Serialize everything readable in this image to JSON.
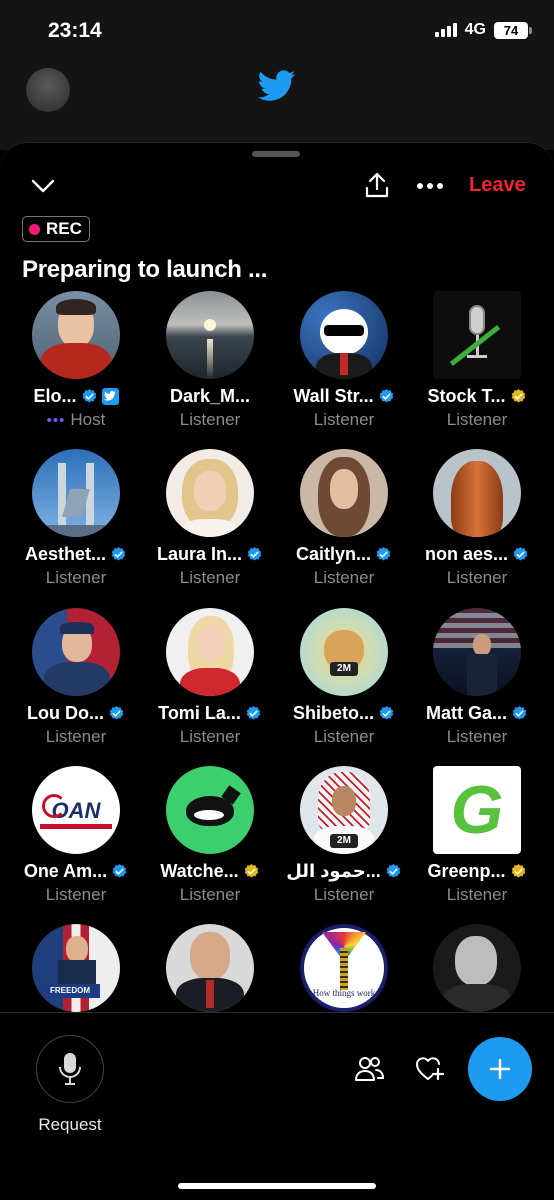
{
  "status_bar": {
    "time": "23:14",
    "network": "4G",
    "battery": "74"
  },
  "header": {
    "leave_label": "Leave",
    "rec_label": "REC",
    "title": "Preparing to launch ..."
  },
  "participants": [
    {
      "name": "Elo...",
      "role": "Host",
      "badge": "blue",
      "extra": "twitter",
      "avatar": "portrait-red",
      "shape": "circle"
    },
    {
      "name": "Dark_M...",
      "role": "Listener",
      "badge": "",
      "avatar": "sunset-sea",
      "shape": "circle"
    },
    {
      "name": "Wall Str...",
      "role": "Listener",
      "badge": "blue",
      "avatar": "cartoon-starry",
      "shape": "circle"
    },
    {
      "name": "Stock T...",
      "role": "Listener",
      "badge": "gold",
      "avatar": "microphone-logo",
      "shape": "square"
    },
    {
      "name": "Aesthet...",
      "role": "Listener",
      "badge": "blue",
      "avatar": "statue-sky",
      "shape": "circle"
    },
    {
      "name": "Laura In...",
      "role": "Listener",
      "badge": "blue",
      "avatar": "portrait-blonde",
      "shape": "circle"
    },
    {
      "name": "Caitlyn...",
      "role": "Listener",
      "badge": "blue",
      "avatar": "portrait-brunette",
      "shape": "circle"
    },
    {
      "name": "non aes...",
      "role": "Listener",
      "badge": "blue",
      "avatar": "copper-hair",
      "shape": "circle"
    },
    {
      "name": "Lou Do...",
      "role": "Listener",
      "badge": "blue",
      "avatar": "portrait-flag",
      "shape": "circle"
    },
    {
      "name": "Tomi La...",
      "role": "Listener",
      "badge": "blue",
      "avatar": "portrait-red-dress",
      "shape": "circle"
    },
    {
      "name": "Shibeto...",
      "role": "Listener",
      "badge": "blue",
      "avatar": "doge-meme",
      "shape": "circle"
    },
    {
      "name": "Matt Ga...",
      "role": "Listener",
      "badge": "blue",
      "avatar": "portrait-stage-flag",
      "shape": "circle"
    },
    {
      "name": "One Am...",
      "role": "Listener",
      "badge": "blue",
      "avatar": "oan-logo",
      "shape": "circle",
      "logo_text": "OAN"
    },
    {
      "name": "Watche...",
      "role": "Listener",
      "badge": "gold",
      "avatar": "whale-logo",
      "shape": "circle"
    },
    {
      "name": "حمود الل...",
      "role": "Listener",
      "badge": "blue",
      "avatar": "portrait-headscarf",
      "shape": "circle",
      "logo_text": "2M"
    },
    {
      "name": "Greenp...",
      "role": "Listener",
      "badge": "gold",
      "avatar": "green-g-logo",
      "shape": "square",
      "logo_text": "G"
    },
    {
      "name": "",
      "role": "",
      "badge": "",
      "avatar": "portrait-podium",
      "shape": "circle",
      "logo_text": "FREEDOM"
    },
    {
      "name": "",
      "role": "",
      "badge": "",
      "avatar": "portrait-suit",
      "shape": "circle"
    },
    {
      "name": "",
      "role": "",
      "badge": "",
      "avatar": "how-things-work-logo",
      "shape": "circle",
      "logo_text": "How things work"
    },
    {
      "name": "",
      "role": "",
      "badge": "",
      "avatar": "portrait-bw",
      "shape": "circle"
    }
  ],
  "bottom_bar": {
    "request_label": "Request"
  },
  "colors": {
    "accent": "#1d9bf0",
    "leave": "#f4212e",
    "rec_dot": "#f91880",
    "verified_gold": "#e2b719",
    "muted": "#8b8b8b",
    "host_dots": "#7856ff"
  }
}
